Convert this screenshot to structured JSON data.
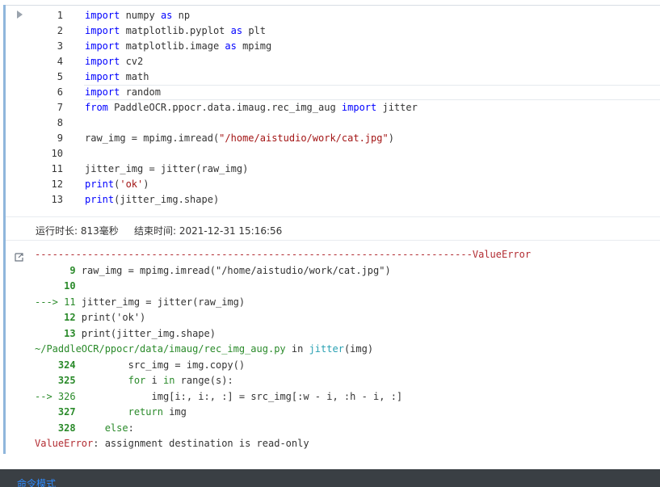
{
  "editor": {
    "lines": [
      {
        "n": "1",
        "parts": [
          [
            "kw",
            "import"
          ],
          [
            "",
            " numpy "
          ],
          [
            "kw",
            "as"
          ],
          [
            "",
            " np"
          ]
        ]
      },
      {
        "n": "2",
        "parts": [
          [
            "kw",
            "import"
          ],
          [
            "",
            " matplotlib.pyplot "
          ],
          [
            "kw",
            "as"
          ],
          [
            "",
            " plt"
          ]
        ]
      },
      {
        "n": "3",
        "parts": [
          [
            "kw",
            "import"
          ],
          [
            "",
            " matplotlib.image "
          ],
          [
            "kw",
            "as"
          ],
          [
            "",
            " mpimg"
          ]
        ]
      },
      {
        "n": "4",
        "parts": [
          [
            "kw",
            "import"
          ],
          [
            "",
            " cv2"
          ]
        ]
      },
      {
        "n": "5",
        "parts": [
          [
            "kw",
            "import"
          ],
          [
            "",
            " math"
          ]
        ]
      },
      {
        "n": "6",
        "parts": [
          [
            "kw",
            "import"
          ],
          [
            "",
            " random"
          ]
        ]
      },
      {
        "n": "7",
        "parts": [
          [
            "kw",
            "from"
          ],
          [
            "",
            " PaddleOCR.ppocr.data.imaug.rec_img_aug "
          ],
          [
            "kw",
            "import"
          ],
          [
            "",
            " jitter"
          ]
        ]
      },
      {
        "n": "8",
        "parts": []
      },
      {
        "n": "9",
        "parts": [
          [
            "",
            "raw_img = mpimg.imread("
          ],
          [
            "str",
            "\"/home/aistudio/work/cat.jpg\""
          ],
          [
            "",
            ")"
          ]
        ]
      },
      {
        "n": "10",
        "parts": []
      },
      {
        "n": "11",
        "parts": [
          [
            "",
            "jitter_img = jitter(raw_img)"
          ]
        ]
      },
      {
        "n": "12",
        "parts": [
          [
            "kw",
            "print"
          ],
          [
            "",
            "("
          ],
          [
            "str",
            "'ok'"
          ],
          [
            "",
            ")"
          ]
        ]
      },
      {
        "n": "13",
        "parts": [
          [
            "kw",
            "print"
          ],
          [
            "",
            "(jitter_img.shape)"
          ]
        ]
      }
    ]
  },
  "exec_info": {
    "duration": "运行时长: 813毫秒",
    "end_time": "结束时间: 2021-12-31 15:16:56"
  },
  "output": {
    "lines": [
      [
        [
          "red",
          "---------------------------------------------------------------------------ValueError"
        ]
      ],
      [
        [
          "bgreen",
          "      9"
        ],
        [
          "gray",
          " raw_img = mpimg.imread(\"/home/aistudio/work/cat.jpg\")"
        ]
      ],
      [
        [
          "bgreen",
          "     10"
        ]
      ],
      [
        [
          "green",
          "---> 11"
        ],
        [
          "gray",
          " jitter_img = jitter(raw_img)"
        ]
      ],
      [
        [
          "bgreen",
          "     12"
        ],
        [
          "gray",
          " print('ok')"
        ]
      ],
      [
        [
          "bgreen",
          "     13"
        ],
        [
          "gray",
          " print(jitter_img.shape)"
        ]
      ],
      [
        [
          "green",
          "~/PaddleOCR/ppocr/data/imaug/rec_img_aug.py"
        ],
        [
          "gray",
          " in "
        ],
        [
          "cyan",
          "jitter"
        ],
        [
          "gray",
          "(img)"
        ]
      ],
      [
        [
          "bgreen",
          "    324"
        ],
        [
          "gray",
          "         src_img = img.copy()"
        ]
      ],
      [
        [
          "bgreen",
          "    325"
        ],
        [
          "gray",
          "         "
        ],
        [
          "green",
          "for"
        ],
        [
          "gray",
          " i "
        ],
        [
          "green",
          "in"
        ],
        [
          "gray",
          " range(s):"
        ]
      ],
      [
        [
          "green",
          "--> 326"
        ],
        [
          "gray",
          "             img[i:, i:, :] = src_img[:w - i, :h - i, :]"
        ]
      ],
      [
        [
          "bgreen",
          "    327"
        ],
        [
          "gray",
          "         "
        ],
        [
          "green",
          "return"
        ],
        [
          "gray",
          " img"
        ]
      ],
      [
        [
          "bgreen",
          "    328"
        ],
        [
          "gray",
          "     "
        ],
        [
          "green",
          "else"
        ],
        [
          "gray",
          ":"
        ]
      ],
      [
        [
          "red",
          "ValueError"
        ],
        [
          "gray",
          ": assignment destination is read-only"
        ]
      ]
    ]
  },
  "statusbar": {
    "mode": "命令模式"
  },
  "colors": {
    "cell_bar": "#8fb6dc",
    "keyword": "#0000ff",
    "string": "#a31515",
    "error": "#b22b31",
    "traceback_green": "#2a8a2a",
    "func_cyan": "#2aa1b3",
    "statusbar_bg": "#3a3f44",
    "mode_text": "#2f8cff"
  },
  "icons": {
    "run": "play-triangle-icon",
    "output": "output-arrow-icon"
  }
}
